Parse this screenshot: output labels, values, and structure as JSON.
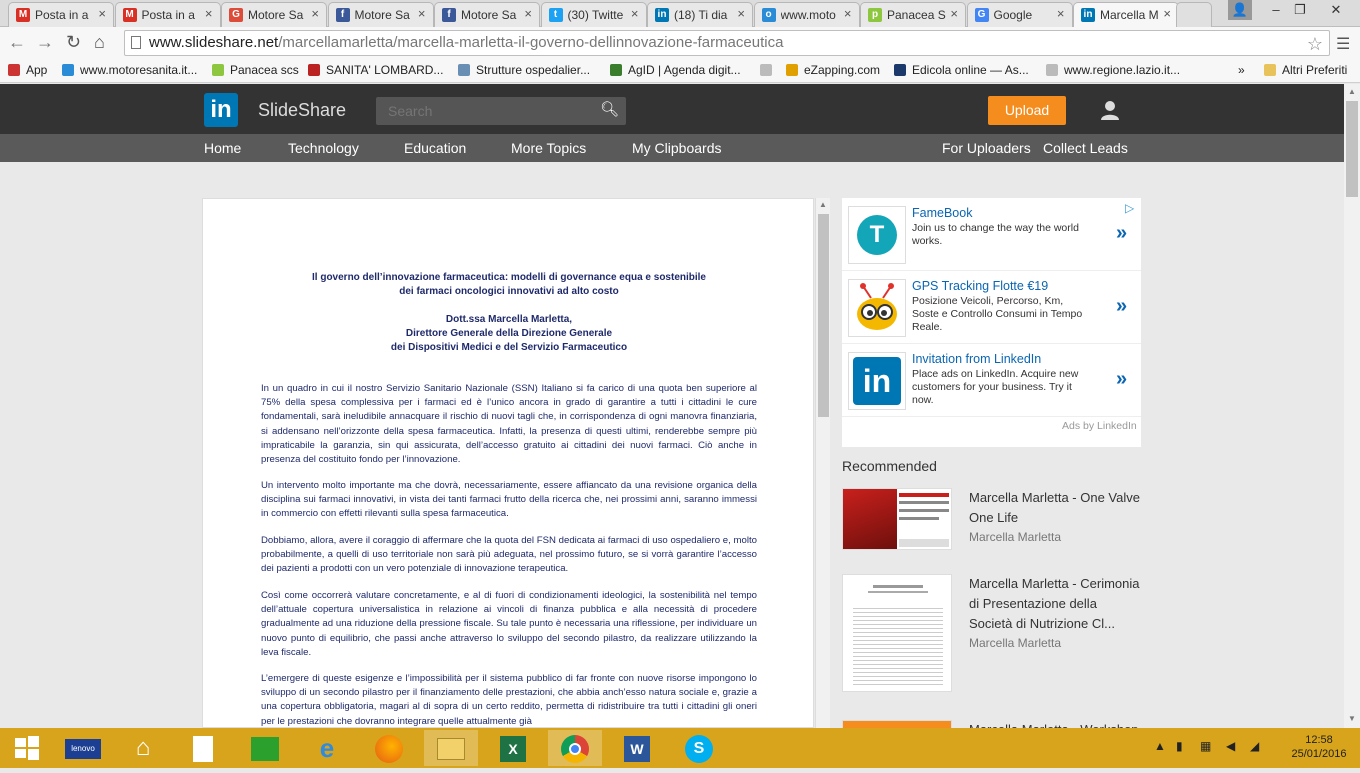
{
  "browser": {
    "tabs": [
      {
        "title": "Posta in a",
        "favicon": "gmail-icon",
        "color": "#d93025",
        "letter": "M"
      },
      {
        "title": "Posta in a",
        "favicon": "gmail-icon",
        "color": "#d93025",
        "letter": "M"
      },
      {
        "title": "Motore Sa",
        "favicon": "google-plus-icon",
        "color": "#dd4b39",
        "letter": "G"
      },
      {
        "title": "Motore Sa",
        "favicon": "facebook-icon",
        "color": "#3b5998",
        "letter": "f"
      },
      {
        "title": "Motore Sa",
        "favicon": "facebook-icon",
        "color": "#3b5998",
        "letter": "f"
      },
      {
        "title": "(30) Twitte",
        "favicon": "twitter-icon",
        "color": "#1da1f2",
        "letter": "t"
      },
      {
        "title": "(18) Ti dia",
        "favicon": "linkedin-icon",
        "color": "#0077b5",
        "letter": "in"
      },
      {
        "title": "www.moto",
        "favicon": "globe-icon",
        "color": "#2a8bd6",
        "letter": "o"
      },
      {
        "title": "Panacea S",
        "favicon": "panacea-icon",
        "color": "#8dc63f",
        "letter": "p"
      },
      {
        "title": "Google",
        "favicon": "google-icon",
        "color": "#4285f4",
        "letter": "G"
      },
      {
        "title": "Marcella M",
        "favicon": "linkedin-icon",
        "color": "#0077b5",
        "letter": "in"
      }
    ],
    "url_domain": "www.slideshare.net",
    "url_path": "/marcellamarletta/marcella-marletta-il-governo-dellinnovazione-farmaceutica",
    "bookmarks": [
      {
        "label": "App",
        "icon": "apps-grid-icon",
        "color": "#c33"
      },
      {
        "label": "www.motoresanita.it...",
        "icon": "globe-icon",
        "color": "#2a8bd6"
      },
      {
        "label": "Panacea scs",
        "icon": "panacea-icon",
        "color": "#8dc63f"
      },
      {
        "label": "SANITA' LOMBARD...",
        "icon": "lombardia-icon",
        "color": "#b22"
      },
      {
        "label": "Strutture ospedalier...",
        "icon": "hospital-icon",
        "color": "#6a8fb5"
      },
      {
        "label": "AgID | Agenda digit...",
        "icon": "agid-icon",
        "color": "#3a7d2c"
      },
      {
        "label": "",
        "icon": "page-icon",
        "color": "#bbb"
      },
      {
        "label": "eZapping.com",
        "icon": "ezapping-icon",
        "color": "#e0a000"
      },
      {
        "label": "Edicola online — As...",
        "icon": "edicola-icon",
        "color": "#1b3a6b"
      },
      {
        "label": "www.regione.lazio.it...",
        "icon": "page-icon",
        "color": "#bbb"
      }
    ],
    "bookmarks_more": "»",
    "other_bookmarks": "Altri Preferiti"
  },
  "slideshare": {
    "brand": "SlideShare",
    "logo_text": "in",
    "search_placeholder": "Search",
    "upload_label": "Upload",
    "nav": [
      "Home",
      "Technology",
      "Education",
      "More Topics",
      "My Clipboards"
    ],
    "nav_right": [
      "For Uploaders",
      "Collect Leads"
    ]
  },
  "document": {
    "title_lines": [
      "Il governo dell’innovazione farmaceutica: modelli di governance equa e sostenibile",
      "dei farmaci oncologici innovativi ad alto costo"
    ],
    "author_lines": [
      "Dott.ssa Marcella Marletta,",
      "Direttore Generale della Direzione Generale",
      "dei Dispositivi Medici e del Servizio Farmaceutico"
    ],
    "paragraphs": [
      "In un quadro in cui il nostro Servizio Sanitario Nazionale (SSN) Italiano si fa carico di una quota ben superiore al 75% della spesa complessiva per i farmaci ed è l’unico ancora in grado di garantire a tutti i cittadini le cure fondamentali, sarà ineludibile annacquare il rischio di nuovi tagli che, in corrispondenza di ogni manovra finanziaria, si addensano nell’orizzonte della spesa farmaceutica. Infatti, la presenza di questi ultimi, renderebbe sempre più impraticabile la garanzia, sin qui assicurata, dell’accesso gratuito ai cittadini dei nuovi farmaci. Ciò anche in presenza del costituito fondo per l’innovazione.",
      "Un intervento molto importante ma che dovrà, necessariamente, essere affiancato da una revisione organica della disciplina sui farmaci innovativi, in vista dei tanti farmaci frutto della ricerca che, nei prossimi anni, saranno immessi in commercio con effetti rilevanti sulla spesa farmaceutica.",
      "Dobbiamo, allora, avere il coraggio di affermare che la quota del FSN dedicata ai farmaci di uso ospedaliero e, molto probabilmente, a quelli di uso territoriale non sarà più adeguata, nel prossimo futuro, se si vorrà garantire l’accesso dei pazienti a prodotti con un vero potenziale di innovazione terapeutica.",
      "Così come occorrerà valutare concretamente, e al di fuori di condizionamenti ideologici, la sostenibilità nel tempo dell’attuale copertura universalistica in relazione ai vincoli di finanza pubblica e alla necessità di procedere gradualmente ad una riduzione della pressione fiscale. Su tale punto è necessaria una riflessione, per individuare un nuovo punto di equilibrio, che passi anche attraverso lo sviluppo del secondo pilastro, da realizzare utilizzando la leva fiscale.",
      "L’emergere di queste esigenze e l’impossibilità per il sistema pubblico di far fronte con nuove risorse impongono lo sviluppo di un secondo pilastro per il finanziamento delle prestazioni, che abbia anch’esso natura sociale e, grazie a una copertura obbligatoria, magari al di sopra di un certo reddito, permetta di ridistribuire tra tutti i cittadini gli oneri per le prestazioni che dovranno integrare quelle attualmente già"
    ]
  },
  "ads": {
    "items": [
      {
        "title": "FameBook",
        "desc": "Join us to change the way the world works.",
        "logo": "famebook-logo-icon",
        "logo_letter": "T"
      },
      {
        "title": "GPS Tracking Flotte €19",
        "desc": "Posizione Veicoli, Percorso, Km, Soste e Controllo Consumi in Tempo Reale.",
        "logo": "gps-bug-logo-icon",
        "logo_letter": ""
      },
      {
        "title": "Invitation from LinkedIn",
        "desc": "Place ads on LinkedIn. Acquire new customers for your business. Try it now.",
        "logo": "linkedin-logo-icon",
        "logo_letter": "in"
      }
    ],
    "arrow": "»",
    "footer": "Ads by LinkedIn"
  },
  "recommended": {
    "heading": "Recommended",
    "items": [
      {
        "title": "Marcella Marletta - One Valve One Life",
        "author": "Marcella Marletta"
      },
      {
        "title": "Marcella Marletta - Cerimonia di Presentazione della Società di Nutrizione Cl...",
        "author": "Marcella Marletta"
      },
      {
        "title": "Marcella Marletta - Workshop",
        "author": ""
      }
    ]
  },
  "taskbar": {
    "apps": [
      "windows-start-icon",
      "lenovo-icon",
      "home-icon",
      "file-icon",
      "store-icon",
      "internet-explorer-icon",
      "firefox-icon",
      "file-explorer-icon",
      "excel-icon",
      "chrome-icon",
      "word-icon",
      "skype-icon"
    ],
    "time": "12:58",
    "date": "25/01/2016"
  },
  "colors": {
    "linkedin_blue": "#0077b5",
    "upload_orange": "#f58c1e",
    "taskbar": "#d7a41c"
  }
}
